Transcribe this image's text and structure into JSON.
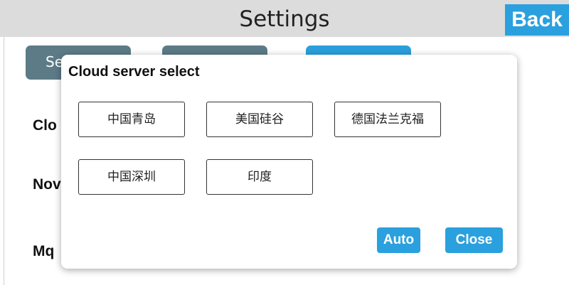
{
  "header": {
    "title": "Settings",
    "back_label": "Back"
  },
  "tabs": [
    {
      "label": "Se"
    },
    {
      "label": ""
    },
    {
      "label": ""
    }
  ],
  "rows": [
    {
      "label": "Clo"
    },
    {
      "label": "Nov"
    },
    {
      "label": "Mq"
    }
  ],
  "dialog": {
    "title": "Cloud server select",
    "options": [
      {
        "label": "中国青岛"
      },
      {
        "label": "美国硅谷"
      },
      {
        "label": "德国法兰克福"
      },
      {
        "label": "中国深圳"
      },
      {
        "label": "印度"
      }
    ],
    "auto_label": "Auto",
    "close_label": "Close"
  },
  "colors": {
    "accent": "#2aa0de",
    "tab_inactive": "#5d7b87",
    "header_bg": "#dcdcdc"
  }
}
